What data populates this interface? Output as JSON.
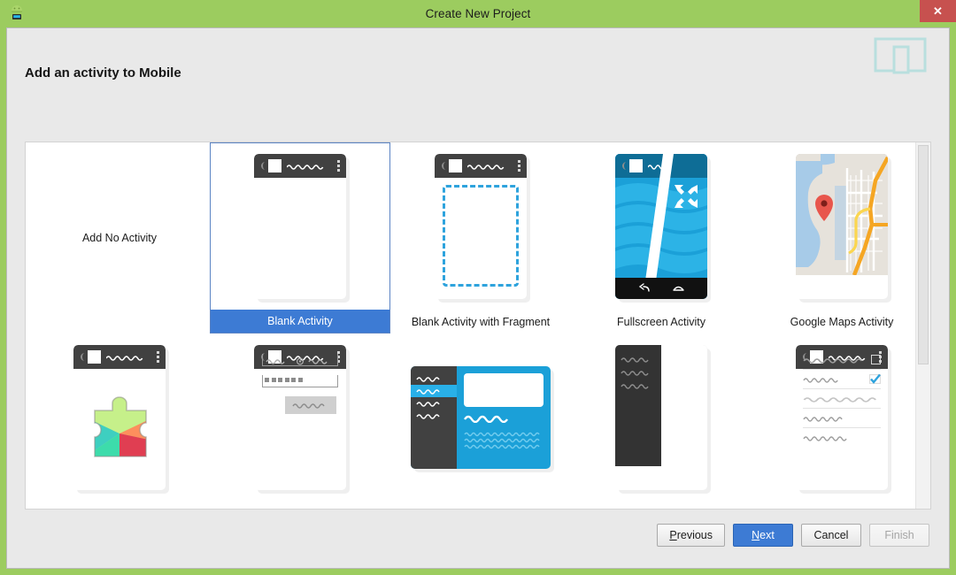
{
  "window": {
    "title": "Create New Project",
    "app_icon": "android-robot-icon",
    "close_label": "✕"
  },
  "header": {
    "heading": "Add an activity to Mobile",
    "device_icon": "tablet-and-phone-icon"
  },
  "templates": [
    {
      "label": "Add No Activity",
      "thumb": "none",
      "selected": false
    },
    {
      "label": "Blank Activity",
      "thumb": "blank",
      "selected": true
    },
    {
      "label": "Blank Activity with Fragment",
      "thumb": "fragment",
      "selected": false
    },
    {
      "label": "Fullscreen Activity",
      "thumb": "fullscreen",
      "selected": false
    },
    {
      "label": "Google Maps Activity",
      "thumb": "maps",
      "selected": false
    },
    {
      "label": "",
      "thumb": "playservices",
      "selected": false
    },
    {
      "label": "",
      "thumb": "login",
      "selected": false
    },
    {
      "label": "",
      "thumb": "masterdetail",
      "selected": false
    },
    {
      "label": "",
      "thumb": "navdrawer",
      "selected": false
    },
    {
      "label": "",
      "thumb": "settings",
      "selected": false
    }
  ],
  "footer": {
    "previous": "Previous",
    "previous_mnemonic": "P",
    "next": "Next",
    "next_mnemonic": "N",
    "cancel": "Cancel",
    "finish": "Finish"
  },
  "colors": {
    "titlebar": "#9ccc5f",
    "close": "#c7514f",
    "selection": "#3d7bd4",
    "dialog": "#e9e9e9",
    "appbar": "#414141",
    "accent_blue": "#1ba0d8"
  }
}
